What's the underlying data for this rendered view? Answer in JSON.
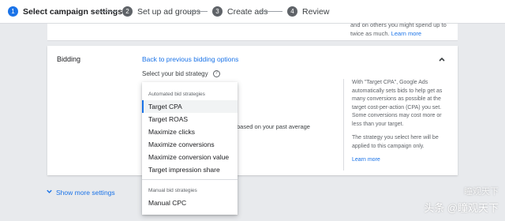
{
  "stepper": {
    "steps": [
      {
        "num": "1",
        "label": "Select campaign settings"
      },
      {
        "num": "2",
        "label": "Set up ad groups"
      },
      {
        "num": "3",
        "label": "Create ads"
      },
      {
        "num": "4",
        "label": "Review"
      }
    ]
  },
  "top_card": {
    "note_text": "and on others you might spend up to twice as much.",
    "learn_more": "Learn more"
  },
  "bidding": {
    "title": "Bidding",
    "back_link": "Back to previous bidding options",
    "strategy_label": "Select your bid strategy",
    "partial_text": "based on your past average",
    "sidebar": {
      "p1": "With \"Target CPA\", Google Ads automatically sets bids to help get as many conversions as possible at the target cost-per-action (CPA) you set. Some conversions may cost more or less than your target.",
      "p2": "The strategy you select here will be applied to this campaign only.",
      "learn_more": "Learn more"
    }
  },
  "show_more": "Show more settings",
  "menu": {
    "automated_label": "Automated bid strategies",
    "automated": [
      "Target CPA",
      "Target ROAS",
      "Maximize clicks",
      "Maximize conversions",
      "Maximize conversion value",
      "Target impression share"
    ],
    "manual_label": "Manual bid strategies",
    "manual": [
      "Manual CPC"
    ],
    "selected": "Target CPA"
  },
  "watermark": {
    "line1": "瞳观天下",
    "line2": "头条 @瞳观天下"
  },
  "colors": {
    "accent": "#1a73e8",
    "text": "#3c4043"
  }
}
